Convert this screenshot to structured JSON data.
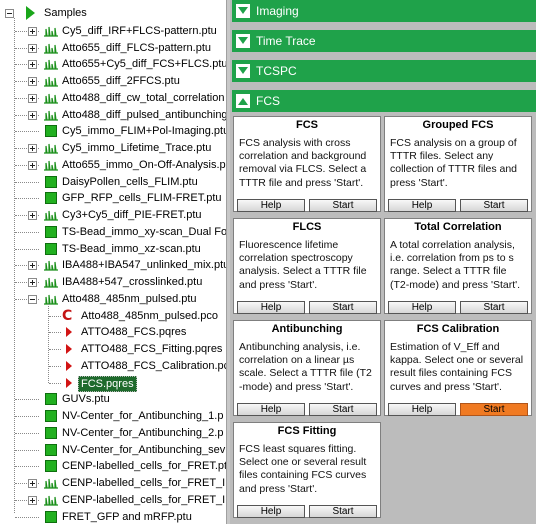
{
  "tree": {
    "root_label": "Samples",
    "items": [
      {
        "label": "Cy5_diff_IRF+FLCS-pattern.ptu",
        "icon": "ptu-trace-icon"
      },
      {
        "label": "Atto655_diff_FLCS-pattern.ptu",
        "icon": "ptu-trace-icon"
      },
      {
        "label": "Atto655+Cy5_diff_FCS+FLCS.ptu",
        "icon": "ptu-trace-icon"
      },
      {
        "label": "Atto655_diff_2FFCS.ptu",
        "icon": "ptu-trace-icon"
      },
      {
        "label": "Atto488_diff_cw_total_correlation",
        "icon": "ptu-trace-icon"
      },
      {
        "label": "Atto488_diff_pulsed_antibunching",
        "icon": "ptu-trace-icon"
      },
      {
        "label": "Cy5_immo_FLIM+Pol-Imaging.ptu",
        "icon": "image-square-icon"
      },
      {
        "label": "Cy5_immo_Lifetime_Trace.ptu",
        "icon": "ptu-trace-icon"
      },
      {
        "label": "Atto655_immo_On-Off-Analysis.p",
        "icon": "ptu-trace-icon"
      },
      {
        "label": "DaisyPollen_cells_FLIM.ptu",
        "icon": "image-square-icon"
      },
      {
        "label": "GFP_RFP_cells_FLIM-FRET.ptu",
        "icon": "image-square-icon"
      },
      {
        "label": "Cy3+Cy5_diff_PIE-FRET.ptu",
        "icon": "ptu-trace-icon"
      },
      {
        "label": "TS-Bead_immo_xy-scan_Dual Fo",
        "icon": "image-square-icon"
      },
      {
        "label": "TS-Bead_immo_xz-scan.ptu",
        "icon": "image-square-icon"
      },
      {
        "label": "IBA488+IBA547_unlinked_mix.ptu",
        "icon": "ptu-trace-icon"
      },
      {
        "label": "IBA488+547_crosslinked.ptu",
        "icon": "ptu-trace-icon"
      },
      {
        "label": "Atto488_485nm_pulsed.ptu",
        "icon": "ptu-trace-icon"
      }
    ],
    "children": [
      {
        "label": "Atto488_485nm_pulsed.pco",
        "icon": "pco-c-icon"
      },
      {
        "label": "ATTO488_FCS.pqres",
        "icon": "pqres-arrow-icon"
      },
      {
        "label": "ATTO488_FCS_Fitting.pqres",
        "icon": "pqres-arrow-icon"
      },
      {
        "label": "ATTO488_FCS_Calibration.pc",
        "icon": "pqres-arrow-icon"
      },
      {
        "label": "FCS.pqres",
        "icon": "pqres-arrow-icon",
        "selected": true
      }
    ],
    "items2": [
      {
        "label": "GUVs.ptu",
        "icon": "image-square-icon"
      },
      {
        "label": "NV-Center_for_Antibunching_1.p",
        "icon": "image-square-icon"
      },
      {
        "label": "NV-Center_for_Antibunching_2.p",
        "icon": "image-square-icon"
      },
      {
        "label": "NV-Center_for_Antibunching_sev",
        "icon": "image-square-icon"
      },
      {
        "label": "CENP-labelled_cells_for_FRET.ptu",
        "icon": "image-square-icon"
      },
      {
        "label": "CENP-labelled_cells_for_FRET_IR",
        "icon": "ptu-trace-icon"
      },
      {
        "label": "CENP-labelled_cells_for_FRET_IR",
        "icon": "ptu-trace-icon"
      },
      {
        "label": "FRET_GFP and mRFP.ptu",
        "icon": "image-square-icon"
      }
    ]
  },
  "sections": [
    {
      "label": "Imaging",
      "expanded": false
    },
    {
      "label": "Time Trace",
      "expanded": false
    },
    {
      "label": "TCSPC",
      "expanded": false
    },
    {
      "label": "FCS",
      "expanded": true
    }
  ],
  "cards": [
    {
      "title": "FCS",
      "desc": "FCS analysis with cross correlation and background removal via FLCS. Select a TTTR file and press 'Start'.",
      "help": "Help",
      "start": "Start"
    },
    {
      "title": "Grouped FCS",
      "desc": "FCS analysis on a group of TTTR files. Select any collection of TTTR files and press 'Start'.",
      "help": "Help",
      "start": "Start"
    },
    {
      "title": "FLCS",
      "desc": "Fluorescence lifetime correlation spectroscopy analysis. Select a TTTR file and press 'Start'.",
      "help": "Help",
      "start": "Start"
    },
    {
      "title": "Total Correlation",
      "desc": "A total correlation analysis, i.e. correlation from ps to s range. Select a TTTR file (T2-mode) and press 'Start'.",
      "help": "Help",
      "start": "Start"
    },
    {
      "title": "Antibunching",
      "desc": "Antibunching analysis, i.e. correlation on a linear µs scale. Select a TTTR file (T2 -mode) and press 'Start'.",
      "help": "Help",
      "start": "Start"
    },
    {
      "title": "FCS Calibration",
      "desc": "Estimation of V_Eff and kappa. Select one or several result files containing FCS curves and press 'Start'.",
      "help": "Help",
      "start": "Start",
      "start_active": true
    },
    {
      "title": "FCS Fitting",
      "desc": "FCS least squares fitting. Select one or several result files containing FCS curves and press 'Start'.",
      "help": "Help",
      "start": "Start"
    }
  ],
  "colors": {
    "section_green": "#1fa24a",
    "selected_bg": "#1e6a2c",
    "start_active": "#f07a22"
  }
}
